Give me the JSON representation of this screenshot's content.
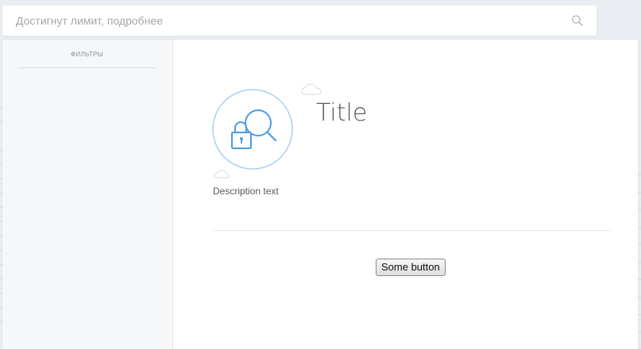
{
  "search": {
    "placeholder": "Достигнут лимит, подробнее",
    "icon": "search-icon"
  },
  "sidebar": {
    "title": "ФИЛЬТРЫ"
  },
  "main": {
    "illustration_icon": "lock-search-icon",
    "title": "Title",
    "description": "Description text",
    "button_label": "Some button"
  },
  "colors": {
    "accent": "#4a9be8",
    "accent_light": "#a9cff0",
    "sidebar_bg": "#f5f7f9",
    "page_bg": "#e9edf1"
  }
}
